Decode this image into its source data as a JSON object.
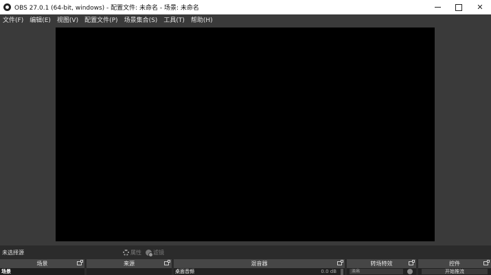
{
  "window": {
    "title": "OBS 27.0.1 (64-bit, windows) - 配置文件: 未命名 - 场景: 未命名",
    "minimize_label": "—",
    "close_label": "✕"
  },
  "menu": [
    {
      "label": "文件(F)"
    },
    {
      "label": "编辑(E)"
    },
    {
      "label": "视图(V)"
    },
    {
      "label": "配置文件(P)"
    },
    {
      "label": "场景集合(S)"
    },
    {
      "label": "工具(T)"
    },
    {
      "label": "帮助(H)"
    }
  ],
  "source_toolbar": {
    "no_source_label": "未选择源",
    "properties_label": "属性",
    "filters_label": "滤镜"
  },
  "docks": {
    "scenes": {
      "title": "场景",
      "items": [
        "场景"
      ]
    },
    "sources": {
      "title": "来源"
    },
    "mixer": {
      "title": "混音器",
      "channel": "桌面音频",
      "level": "0.0 dB"
    },
    "transitions": {
      "title": "转场特效",
      "selected": "淡出"
    },
    "controls": {
      "title": "控件",
      "start_streaming": "开始推流"
    }
  },
  "colors": {
    "background": "#3a3a3a",
    "preview": "#000000",
    "dock_header": "#464646",
    "dock_body": "#222222"
  }
}
